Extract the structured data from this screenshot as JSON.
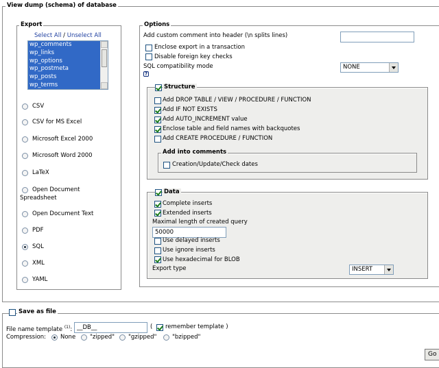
{
  "main_legend": "View dump (schema) of database",
  "export": {
    "legend": "Export",
    "select_all": "Select All",
    "separator": " / ",
    "unselect_all": "Unselect All",
    "tables": [
      "wp_comments",
      "wp_links",
      "wp_options",
      "wp_postmeta",
      "wp_posts",
      "wp_terms"
    ],
    "formats": [
      {
        "label": "CSV",
        "selected": false
      },
      {
        "label": "CSV for MS Excel",
        "selected": false
      },
      {
        "label": "Microsoft Excel 2000",
        "selected": false
      },
      {
        "label": "Microsoft Word 2000",
        "selected": false
      },
      {
        "label": "LaTeX",
        "selected": false
      },
      {
        "label": "Open Document",
        "label2": "Spreadsheet",
        "selected": false
      },
      {
        "label": "Open Document Text",
        "selected": false
      },
      {
        "label": "PDF",
        "selected": false
      },
      {
        "label": "SQL",
        "selected": true
      },
      {
        "label": "XML",
        "selected": false
      },
      {
        "label": "YAML",
        "selected": false
      }
    ]
  },
  "options": {
    "legend": "Options",
    "custom_comment_label": "Add custom comment into header (\\n splits lines)",
    "custom_comment_value": "",
    "enclose_transaction": "Enclose export in a transaction",
    "disable_fk": "Disable foreign key checks",
    "sql_compat_label": "SQL compatibility mode",
    "sql_compat_value": "NONE",
    "help_icon": "?"
  },
  "structure": {
    "legend": "Structure",
    "items": [
      {
        "label": "Add DROP TABLE / VIEW / PROCEDURE / FUNCTION",
        "checked": false
      },
      {
        "label": "Add IF NOT EXISTS",
        "checked": true
      },
      {
        "label": "Add AUTO_INCREMENT value",
        "checked": true
      },
      {
        "label": "Enclose table and field names with backquotes",
        "checked": true
      },
      {
        "label": "Add CREATE PROCEDURE / FUNCTION",
        "checked": false
      }
    ],
    "comments_legend": "Add into comments",
    "comments_item": "Creation/Update/Check dates"
  },
  "data": {
    "legend": "Data",
    "complete_inserts": "Complete inserts",
    "extended_inserts": "Extended inserts",
    "max_length_label": "Maximal length of created query",
    "max_length_value": "50000",
    "delayed_inserts": "Use delayed inserts",
    "ignore_inserts": "Use ignore inserts",
    "hex_blob": "Use hexadecimal for BLOB",
    "export_type_label": "Export type",
    "export_type_value": "INSERT"
  },
  "save": {
    "legend": "Save as file",
    "file_template_label": "File name template",
    "file_template_sup": "(1)",
    "file_template_colon": ":",
    "file_template_value": "__DB__",
    "paren_open": "(",
    "remember_template": "remember template )",
    "compression_label": "Compression:",
    "compression_options": [
      "None",
      "\"zipped\"",
      "\"gzipped\"",
      "\"bzipped\""
    ],
    "go_label": "Go"
  }
}
